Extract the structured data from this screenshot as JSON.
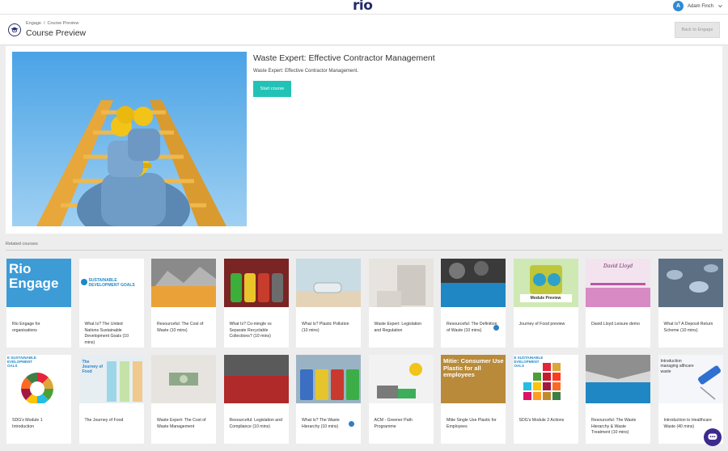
{
  "topbar": {
    "logo": "rio",
    "user_initial": "A",
    "user_name": "Adam Finch"
  },
  "header": {
    "breadcrumb": [
      "Engage",
      "/",
      "Course Preview"
    ],
    "title": "Course Preview",
    "back_label": "Back to Engage"
  },
  "course": {
    "title": "Waste Expert: Effective Contractor Management",
    "description": "Waste Expert: Effective Contractor Management.",
    "start_label": "Start course"
  },
  "related": {
    "label": "Related courses",
    "cards": [
      {
        "title": "Rio Engage for organisations",
        "thumb_text": "Rio Engage"
      },
      {
        "title": "What Is? The United Nations Sustainable Development Goals (10 mins)",
        "thumb_text": "SUSTAINABLE DEVELOPMENT GOALS"
      },
      {
        "title": "Resourceful: The Cost of Waste (10 mins)",
        "thumb_text": ""
      },
      {
        "title": "What Is? Co-mingle vs Separate Recyclable Collections? (10 mins)",
        "thumb_text": ""
      },
      {
        "title": "What Is? Plastic Pollution (10 mins)",
        "thumb_text": ""
      },
      {
        "title": "Waste Expert: Legislation and Regulation",
        "thumb_text": ""
      },
      {
        "title": "Resourceful: The Definition of Waste (10 mins)",
        "thumb_text": ""
      },
      {
        "title": "Journey of Food preview",
        "thumb_text": "Module Preview"
      },
      {
        "title": "David Lloyd Leisure demo",
        "thumb_text": "David Lloyd"
      },
      {
        "title": "What Is? A Deposit Return Scheme (10 mins)",
        "thumb_text": ""
      },
      {
        "title": "SDG's Module 1 Introduction",
        "thumb_text": "E SUSTAINABLE EVELOPMENT OALS"
      },
      {
        "title": "The Journey of Food",
        "thumb_text": "The Journey of Food"
      },
      {
        "title": "Waste Expert: The Cost of Waste Management",
        "thumb_text": ""
      },
      {
        "title": "Resourceful: Legislation and Compliance (10 mins)",
        "thumb_text": ""
      },
      {
        "title": "What Is? The Waste Hierarchy (10 mins)",
        "thumb_text": ""
      },
      {
        "title": "ACM - Greener Path Programme",
        "thumb_text": ""
      },
      {
        "title": "Mitie Single Use Plastic for Employees",
        "thumb_text": "Mitie: Consumer Use Plastic for all employees"
      },
      {
        "title": "SDG's Module 2 Actions",
        "thumb_text": "E SUSTAINABLE EVELOPMENT OALS"
      },
      {
        "title": "Resourceful: The Waste Hierarchy & Waste Treatment (10 mins)",
        "thumb_text": ""
      },
      {
        "title": "Introduction to Healthcare Waste (40 mins)",
        "thumb_text": "Introduction managing althcare waste"
      }
    ]
  },
  "colors": {
    "accent": "#22c3b6",
    "brand": "#232b6b",
    "chat": "#3d2a8c"
  }
}
